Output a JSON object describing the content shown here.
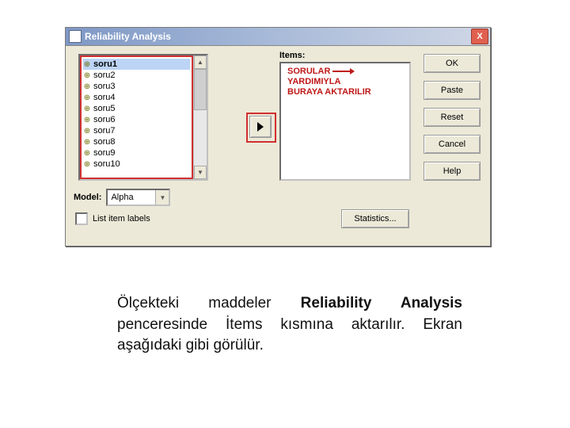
{
  "dialog": {
    "title": "Reliability Analysis",
    "close": "X"
  },
  "source_list": {
    "items": [
      {
        "label": "soru1",
        "selected": true
      },
      {
        "label": "soru2",
        "selected": false
      },
      {
        "label": "soru3",
        "selected": false
      },
      {
        "label": "soru4",
        "selected": false
      },
      {
        "label": "soru5",
        "selected": false
      },
      {
        "label": "soru6",
        "selected": false
      },
      {
        "label": "soru7",
        "selected": false
      },
      {
        "label": "soru8",
        "selected": false
      },
      {
        "label": "soru9",
        "selected": false
      },
      {
        "label": "soru10",
        "selected": false
      }
    ]
  },
  "items_label": "Items:",
  "annotation": {
    "line1a": "SORULAR",
    "line1b": "YARDIMIYLA",
    "line2": "BURAYA AKTARILIR"
  },
  "model": {
    "label": "Model:",
    "value": "Alpha"
  },
  "checkbox": {
    "label": "List item labels",
    "checked": false
  },
  "buttons": {
    "ok": "OK",
    "paste": "Paste",
    "reset": "Reset",
    "cancel": "Cancel",
    "help": "Help",
    "statistics": "Statistics..."
  },
  "caption": {
    "part1": "Ölçekteki maddeler ",
    "bold": "Reliability Analysis",
    "part2": " penceresinde İtems kısmına aktarılır. Ekran aşağıdaki gibi görülür."
  }
}
